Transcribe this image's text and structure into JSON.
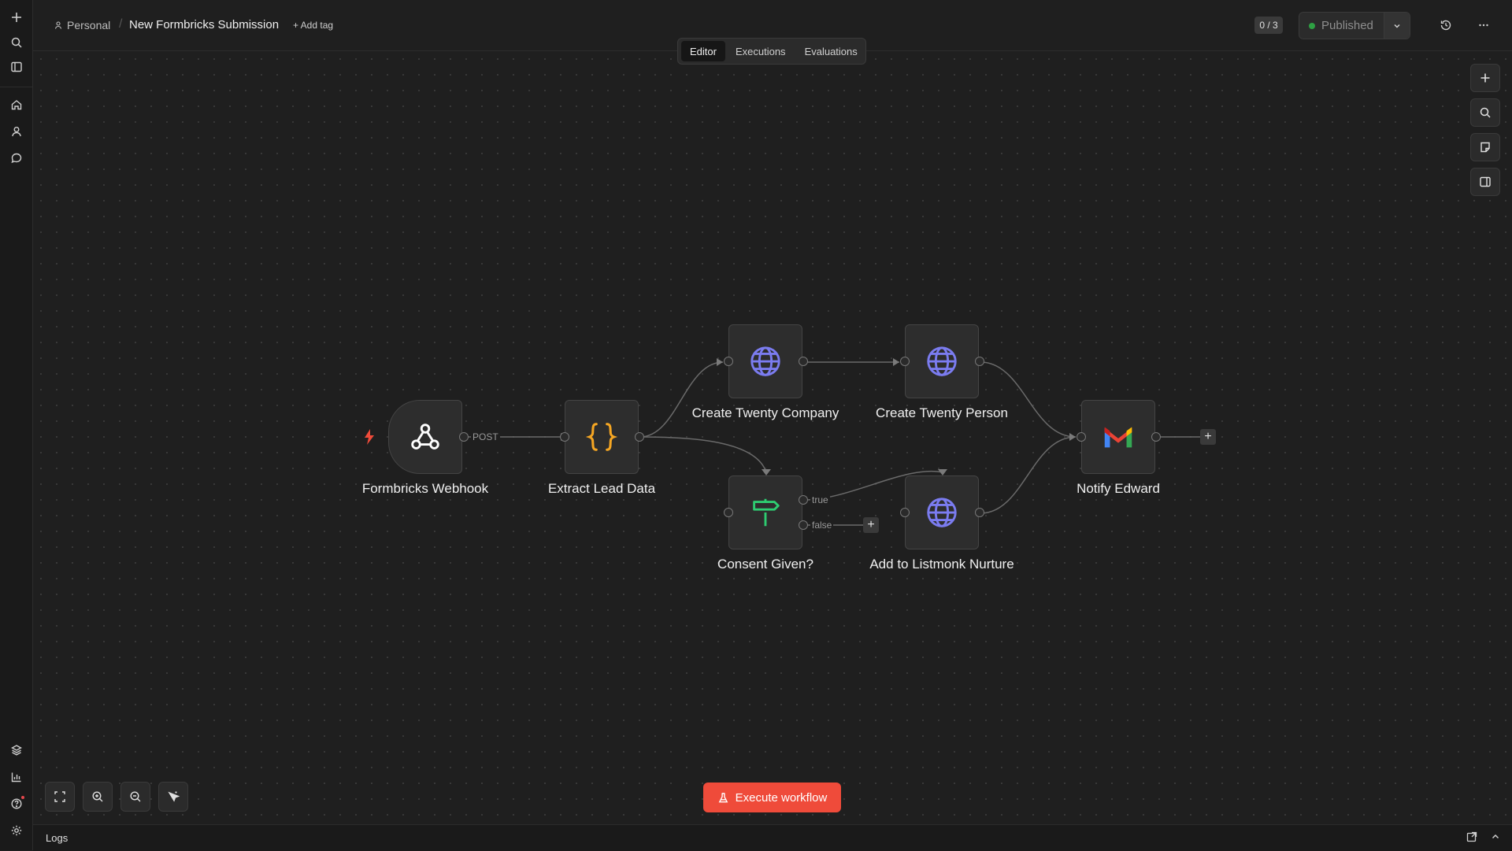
{
  "breadcrumb": {
    "project": "Personal",
    "separator": "/",
    "workflow_name": "New Formbricks Submission",
    "add_tag": "+ Add tag"
  },
  "header": {
    "counter": "0 / 3",
    "publish_status": "Published",
    "status_color": "#2ea043"
  },
  "tabs": [
    {
      "label": "Editor",
      "active": true
    },
    {
      "label": "Executions",
      "active": false
    },
    {
      "label": "Evaluations",
      "active": false
    }
  ],
  "nodes": [
    {
      "id": "webhook",
      "label": "Formbricks Webhook",
      "icon": "webhook-icon"
    },
    {
      "id": "extract",
      "label": "Extract Lead Data",
      "icon": "code-braces-icon"
    },
    {
      "id": "company",
      "label": "Create Twenty Company",
      "icon": "globe-icon"
    },
    {
      "id": "person",
      "label": "Create Twenty Person",
      "icon": "globe-icon"
    },
    {
      "id": "consent",
      "label": "Consent Given?",
      "icon": "signpost-icon"
    },
    {
      "id": "listmonk",
      "label": "Add to Listmonk Nurture",
      "icon": "globe-icon"
    },
    {
      "id": "notify",
      "label": "Notify Edward",
      "icon": "gmail-icon"
    }
  ],
  "edge_labels": {
    "post": "POST",
    "true": "true",
    "false": "false"
  },
  "execute_button": "Execute workflow",
  "logs": {
    "label": "Logs"
  },
  "colors": {
    "accent": "#ef4b3a",
    "globe": "#7b7cf0",
    "braces": "#f5a623",
    "branch": "#2ecc71"
  }
}
